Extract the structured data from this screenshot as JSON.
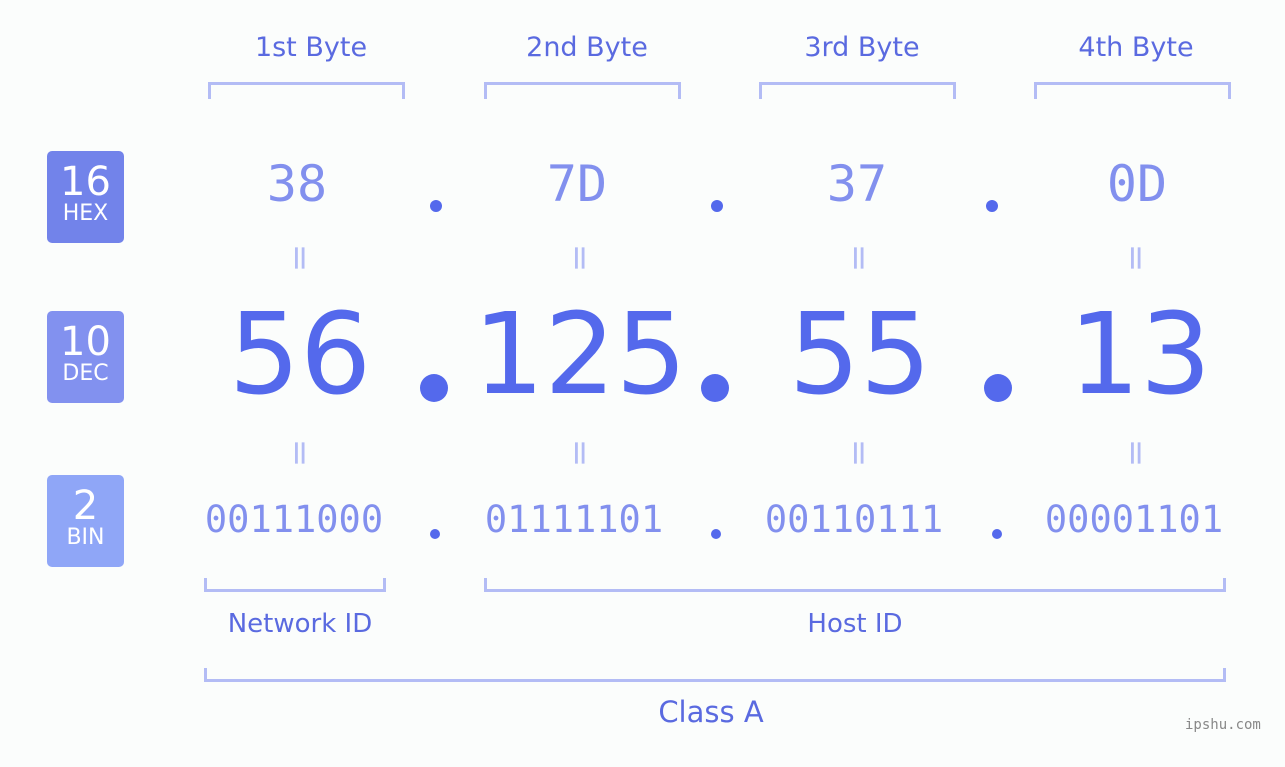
{
  "bytes": [
    {
      "label": "1st Byte",
      "hex": "38",
      "dec": "56",
      "bin": "00111000"
    },
    {
      "label": "2nd Byte",
      "hex": "7D",
      "dec": "125",
      "bin": "01111101"
    },
    {
      "label": "3rd Byte",
      "hex": "37",
      "dec": "55",
      "bin": "00110111"
    },
    {
      "label": "4th Byte",
      "hex": "0D",
      "dec": "13",
      "bin": "00001101"
    }
  ],
  "badges": {
    "hex": {
      "num": "16",
      "label": "HEX",
      "color": "#7283ea"
    },
    "dec": {
      "num": "10",
      "label": "DEC",
      "color": "#8291ef"
    },
    "bin": {
      "num": "2",
      "label": "BIN",
      "color": "#8fa6f7"
    }
  },
  "eq_symbol": "=",
  "network_label": "Network ID",
  "host_label": "Host ID",
  "class_label": "Class A",
  "watermark": "ipshu.com"
}
